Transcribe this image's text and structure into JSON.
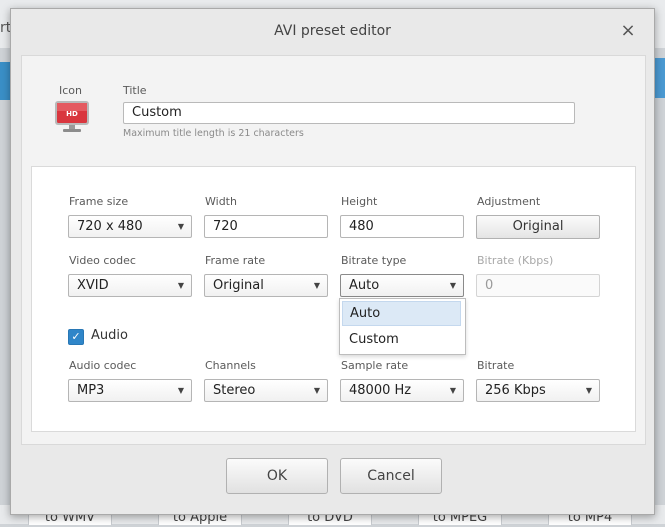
{
  "background": {
    "left_fragment": "rt",
    "bottom_tabs": [
      "to WMV",
      "to Apple",
      "to DVD",
      "to MPEG",
      "to MP4"
    ]
  },
  "dialog": {
    "title": "AVI preset editor",
    "close_glyph": "×"
  },
  "preset": {
    "icon_label": "Icon",
    "icon_badge": "HD",
    "title_label": "Title",
    "title_value": "Custom",
    "title_hint": "Maximum title length is 21 characters"
  },
  "video": {
    "frame_size_label": "Frame size",
    "frame_size_value": "720 x 480",
    "width_label": "Width",
    "width_value": "720",
    "height_label": "Height",
    "height_value": "480",
    "adjustment_label": "Adjustment",
    "adjustment_value": "Original",
    "codec_label": "Video codec",
    "codec_value": "XVID",
    "frame_rate_label": "Frame rate",
    "frame_rate_value": "Original",
    "bitrate_type_label": "Bitrate type",
    "bitrate_type_value": "Auto",
    "bitrate_kbps_label": "Bitrate (Kbps)",
    "bitrate_kbps_value": "0"
  },
  "bitrate_type_menu": [
    "Auto",
    "Custom"
  ],
  "audio": {
    "enabled_label": "Audio",
    "enabled": true,
    "codec_label": "Audio codec",
    "codec_value": "MP3",
    "channels_label": "Channels",
    "channels_value": "Stereo",
    "sample_rate_label": "Sample rate",
    "sample_rate_value": "48000 Hz",
    "bitrate_label": "Bitrate",
    "bitrate_value": "256 Kbps"
  },
  "footer": {
    "ok_label": "OK",
    "cancel_label": "Cancel"
  },
  "colors": {
    "accent": "#2f86c9",
    "icon_red": "#d9363e"
  }
}
